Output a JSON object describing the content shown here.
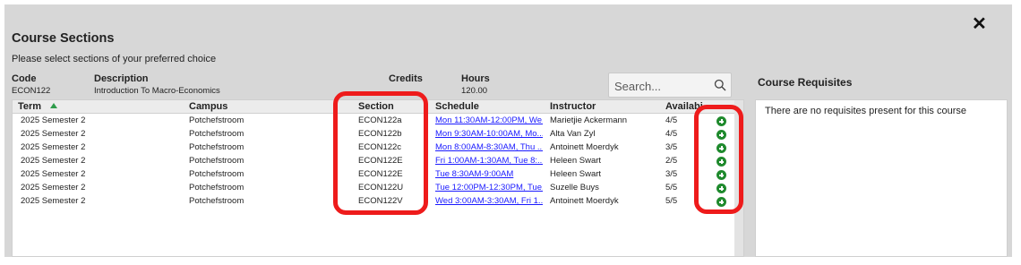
{
  "dialog": {
    "title": "Course Sections",
    "subtitle": "Please select sections of your preferred choice",
    "close_glyph": "✕"
  },
  "course_info": {
    "code_label": "Code",
    "code_value": "ECON122",
    "description_label": "Description",
    "description_value": "Introduction To Macro-Economics",
    "credits_label": "Credits",
    "credits_value": "",
    "hours_label": "Hours",
    "hours_value": "120.00"
  },
  "search": {
    "placeholder": "Search...",
    "value": ""
  },
  "table": {
    "columns": [
      "Term",
      "Campus",
      "Section",
      "Schedule",
      "Instructor",
      "Availabi"
    ],
    "sort_column": "Term",
    "rows": [
      [
        "2025 Semester 2",
        "Potchefstroom",
        "ECON122a",
        "Mon 11:30AM-12:00PM, We...",
        "Marietjie Ackermann",
        "4/5"
      ],
      [
        "2025 Semester 2",
        "Potchefstroom",
        "ECON122b",
        "Mon 9:30AM-10:00AM, Mo...",
        "Alta Van Zyl",
        "4/5"
      ],
      [
        "2025 Semester 2",
        "Potchefstroom",
        "ECON122c",
        "Mon 8:00AM-8:30AM, Thu ...",
        "Antoinett Moerdyk",
        "3/5"
      ],
      [
        "2025 Semester 2",
        "Potchefstroom",
        "ECON122E",
        "Fri 1:00AM-1:30AM, Tue 8:...",
        "Heleen Swart",
        "2/5"
      ],
      [
        "2025 Semester 2",
        "Potchefstroom",
        "ECON122E",
        "Tue 8:30AM-9:00AM",
        "Heleen Swart",
        "3/5"
      ],
      [
        "2025 Semester 2",
        "Potchefstroom",
        "ECON122U",
        "Tue 12:00PM-12:30PM, Tue...",
        "Suzelle Buys",
        "5/5"
      ],
      [
        "2025 Semester 2",
        "Potchefstroom",
        "ECON122V",
        "Wed 3:00AM-3:30AM, Fri 1...",
        "Antoinett Moerdyk",
        "5/5"
      ]
    ]
  },
  "requisites": {
    "title": "Course Requisites",
    "message": "There are no requisites present for this course"
  },
  "colors": {
    "panel_bg": "#d7d7d7",
    "highlight": "#ee1b1b",
    "add_button": "#1f8a2d",
    "link": "#1a1aff",
    "sort_arrow": "#2e9b4a"
  },
  "icons": {
    "close": "close-icon",
    "search": "search-icon",
    "add": "plus-circle-icon",
    "sort": "sort-ascending-icon"
  }
}
